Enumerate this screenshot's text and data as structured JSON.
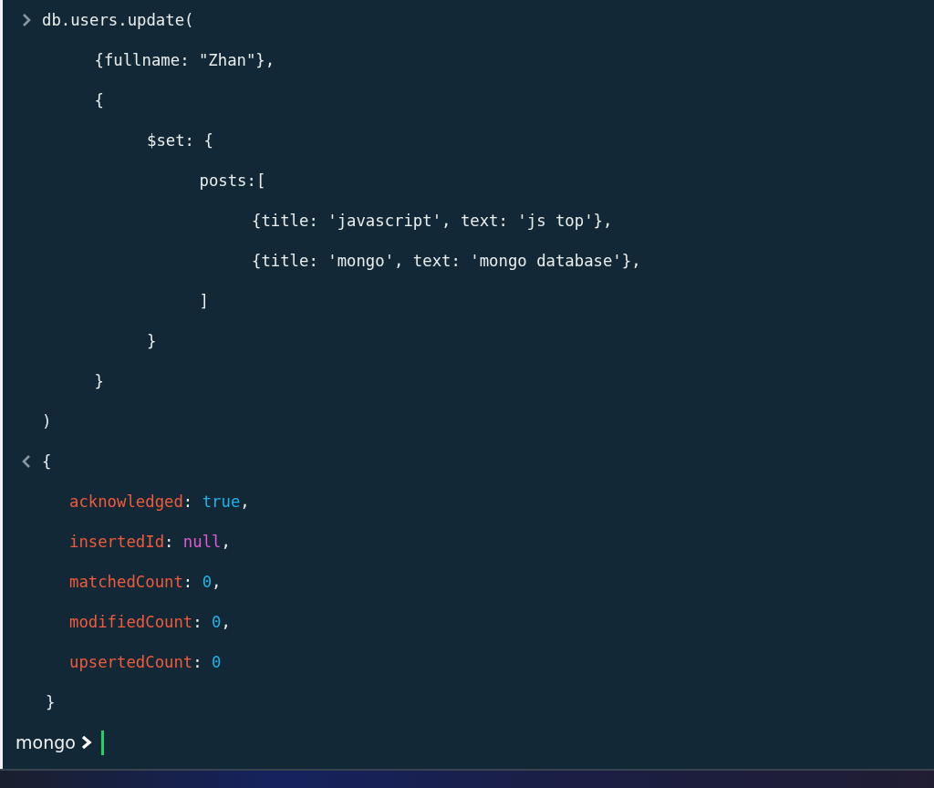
{
  "input": {
    "lines": [
      {
        "text": "db.users.update(",
        "children": [
          {
            "text": "{fullname: \"Zhan\"},"
          },
          {
            "text": "{",
            "children": [
              {
                "text": "$set: {",
                "children": [
                  {
                    "text": "posts:[",
                    "children": [
                      {
                        "text": "{title: 'javascript', text: 'js top'},"
                      },
                      {
                        "text": "{title: 'mongo', text: 'mongo database'},"
                      }
                    ]
                  },
                  {
                    "text": "]"
                  }
                ]
              },
              {
                "text": "}"
              }
            ]
          },
          {
            "text": "}"
          }
        ]
      },
      {
        "text": ")"
      }
    ]
  },
  "output": {
    "lines": [
      [
        {
          "text": "{",
          "kind": "punct"
        }
      ],
      [
        {
          "text": "acknowledged",
          "kind": "key"
        },
        {
          "text": ": ",
          "kind": "punct"
        },
        {
          "text": "true",
          "kind": "boolean"
        },
        {
          "text": ",",
          "kind": "punct"
        }
      ],
      [
        {
          "text": "insertedId",
          "kind": "key"
        },
        {
          "text": ": ",
          "kind": "punct"
        },
        {
          "text": "null",
          "kind": "null"
        },
        {
          "text": ",",
          "kind": "punct"
        }
      ],
      [
        {
          "text": "matchedCount",
          "kind": "key"
        },
        {
          "text": ": ",
          "kind": "punct"
        },
        {
          "text": "0",
          "kind": "number"
        },
        {
          "text": ",",
          "kind": "punct"
        }
      ],
      [
        {
          "text": "modifiedCount",
          "kind": "key"
        },
        {
          "text": ": ",
          "kind": "punct"
        },
        {
          "text": "0",
          "kind": "number"
        },
        {
          "text": ",",
          "kind": "punct"
        }
      ],
      [
        {
          "text": "upsertedCount",
          "kind": "key"
        },
        {
          "text": ": ",
          "kind": "punct"
        },
        {
          "text": "0",
          "kind": "number"
        }
      ],
      [
        {
          "text": "}",
          "kind": "punct"
        }
      ]
    ]
  },
  "prompt": {
    "label": "mongo"
  }
}
